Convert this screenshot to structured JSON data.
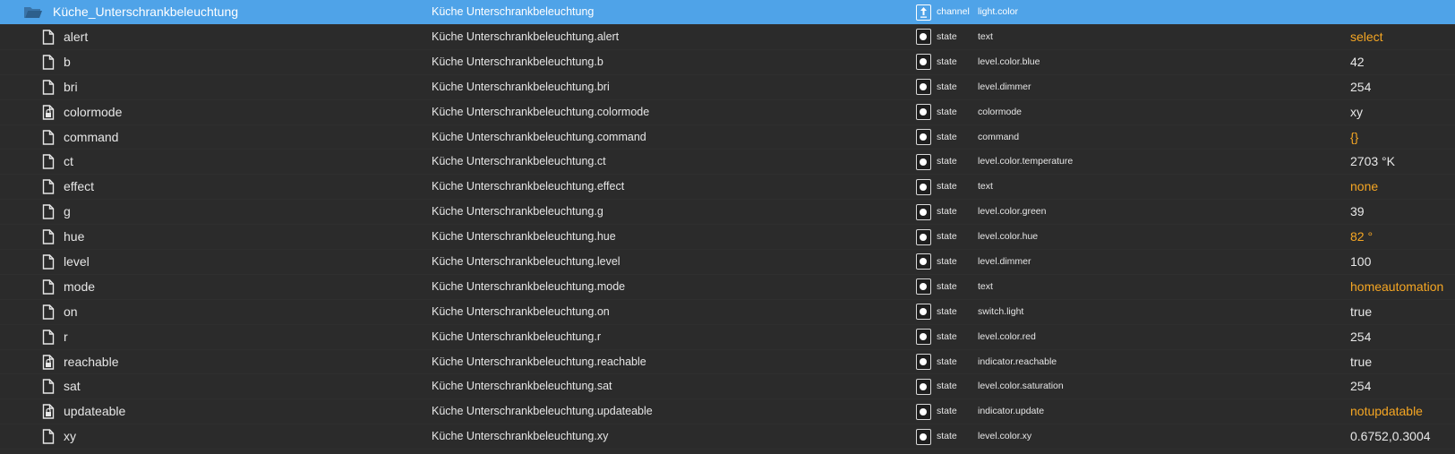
{
  "colors": {
    "selected_bg": "#4fa3e8",
    "orange": "#f5a623"
  },
  "channel": {
    "name": "Küche_Unterschrankbeleuchtung",
    "title": "Küche Unterschrankbeleuchtung",
    "type": "channel",
    "role": "light.color",
    "icon": "folder-open-icon",
    "type_icon": "channel-icon"
  },
  "states": [
    {
      "name": "alert",
      "title": "Küche Unterschrankbeleuchtung.alert",
      "type": "state",
      "role": "text",
      "value": "select",
      "value_color": "orange",
      "icon": "file-icon"
    },
    {
      "name": "b",
      "title": "Küche Unterschrankbeleuchtung.b",
      "type": "state",
      "role": "level.color.blue",
      "value": "42",
      "value_color": "white",
      "icon": "file-icon"
    },
    {
      "name": "bri",
      "title": "Küche Unterschrankbeleuchtung.bri",
      "type": "state",
      "role": "level.dimmer",
      "value": "254",
      "value_color": "white",
      "icon": "file-icon"
    },
    {
      "name": "colormode",
      "title": "Küche Unterschrankbeleuchtung.colormode",
      "type": "state",
      "role": "colormode",
      "value": "xy",
      "value_color": "white",
      "icon": "file-lock-icon"
    },
    {
      "name": "command",
      "title": "Küche Unterschrankbeleuchtung.command",
      "type": "state",
      "role": "command",
      "value": "{}",
      "value_color": "orange",
      "icon": "file-icon"
    },
    {
      "name": "ct",
      "title": "Küche Unterschrankbeleuchtung.ct",
      "type": "state",
      "role": "level.color.temperature",
      "value": "2703 °K",
      "value_color": "white",
      "icon": "file-icon"
    },
    {
      "name": "effect",
      "title": "Küche Unterschrankbeleuchtung.effect",
      "type": "state",
      "role": "text",
      "value": "none",
      "value_color": "orange",
      "icon": "file-icon"
    },
    {
      "name": "g",
      "title": "Küche Unterschrankbeleuchtung.g",
      "type": "state",
      "role": "level.color.green",
      "value": "39",
      "value_color": "white",
      "icon": "file-icon"
    },
    {
      "name": "hue",
      "title": "Küche Unterschrankbeleuchtung.hue",
      "type": "state",
      "role": "level.color.hue",
      "value": "82 °",
      "value_color": "orange",
      "icon": "file-icon"
    },
    {
      "name": "level",
      "title": "Küche Unterschrankbeleuchtung.level",
      "type": "state",
      "role": "level.dimmer",
      "value": "100",
      "value_color": "white",
      "icon": "file-icon"
    },
    {
      "name": "mode",
      "title": "Küche Unterschrankbeleuchtung.mode",
      "type": "state",
      "role": "text",
      "value": "homeautomation",
      "value_color": "orange",
      "icon": "file-icon"
    },
    {
      "name": "on",
      "title": "Küche Unterschrankbeleuchtung.on",
      "type": "state",
      "role": "switch.light",
      "value": "true",
      "value_color": "white",
      "icon": "file-icon"
    },
    {
      "name": "r",
      "title": "Küche Unterschrankbeleuchtung.r",
      "type": "state",
      "role": "level.color.red",
      "value": "254",
      "value_color": "white",
      "icon": "file-icon"
    },
    {
      "name": "reachable",
      "title": "Küche Unterschrankbeleuchtung.reachable",
      "type": "state",
      "role": "indicator.reachable",
      "value": "true",
      "value_color": "white",
      "icon": "file-lock-icon"
    },
    {
      "name": "sat",
      "title": "Küche Unterschrankbeleuchtung.sat",
      "type": "state",
      "role": "level.color.saturation",
      "value": "254",
      "value_color": "white",
      "icon": "file-icon"
    },
    {
      "name": "updateable",
      "title": "Küche Unterschrankbeleuchtung.updateable",
      "type": "state",
      "role": "indicator.update",
      "value": "notupdatable",
      "value_color": "orange",
      "icon": "file-lock-icon"
    },
    {
      "name": "xy",
      "title": "Küche Unterschrankbeleuchtung.xy",
      "type": "state",
      "role": "level.color.xy",
      "value": "0.6752,0.3004",
      "value_color": "white",
      "icon": "file-icon"
    }
  ]
}
